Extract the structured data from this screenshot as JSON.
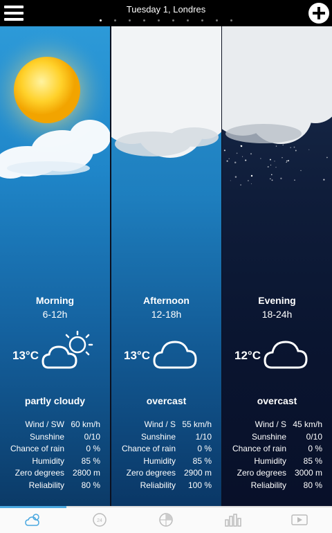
{
  "header": {
    "title": "Tuesday 1, Londres",
    "page_count": 10,
    "active_page": 0
  },
  "periods": [
    {
      "name": "Morning",
      "hours": "6-12h",
      "temp": "13°C",
      "icon": "partly-cloudy-icon",
      "condition": "partly cloudy",
      "details": [
        {
          "label": "Wind / SW",
          "value": "60 km/h"
        },
        {
          "label": "Sunshine",
          "value": "0/10"
        },
        {
          "label": "Chance of rain",
          "value": "0 %"
        },
        {
          "label": "Humidity",
          "value": "85 %"
        },
        {
          "label": "Zero degrees",
          "value": "2800 m"
        },
        {
          "label": "Reliability",
          "value": "80 %"
        }
      ]
    },
    {
      "name": "Afternoon",
      "hours": "12-18h",
      "temp": "13°C",
      "icon": "cloud-icon",
      "condition": "overcast",
      "details": [
        {
          "label": "Wind / S",
          "value": "55 km/h"
        },
        {
          "label": "Sunshine",
          "value": "1/10"
        },
        {
          "label": "Chance of rain",
          "value": "0 %"
        },
        {
          "label": "Humidity",
          "value": "85 %"
        },
        {
          "label": "Zero degrees",
          "value": "2900 m"
        },
        {
          "label": "Reliability",
          "value": "100 %"
        }
      ]
    },
    {
      "name": "Evening",
      "hours": "18-24h",
      "temp": "12°C",
      "icon": "cloud-icon",
      "condition": "overcast",
      "details": [
        {
          "label": "Wind / S",
          "value": "45 km/h"
        },
        {
          "label": "Sunshine",
          "value": "0/10"
        },
        {
          "label": "Chance of rain",
          "value": "0 %"
        },
        {
          "label": "Humidity",
          "value": "85 %"
        },
        {
          "label": "Zero degrees",
          "value": "3000 m"
        },
        {
          "label": "Reliability",
          "value": "80 %"
        }
      ]
    }
  ],
  "tabs": [
    {
      "icon": "weather-icon",
      "active": true
    },
    {
      "icon": "24h-icon",
      "active": false
    },
    {
      "icon": "radar-icon",
      "active": false
    },
    {
      "icon": "bar-chart-icon",
      "active": false
    },
    {
      "icon": "video-icon",
      "active": false
    }
  ],
  "colors": {
    "accent": "#4aa8e0",
    "sun": "#f7c21a"
  }
}
